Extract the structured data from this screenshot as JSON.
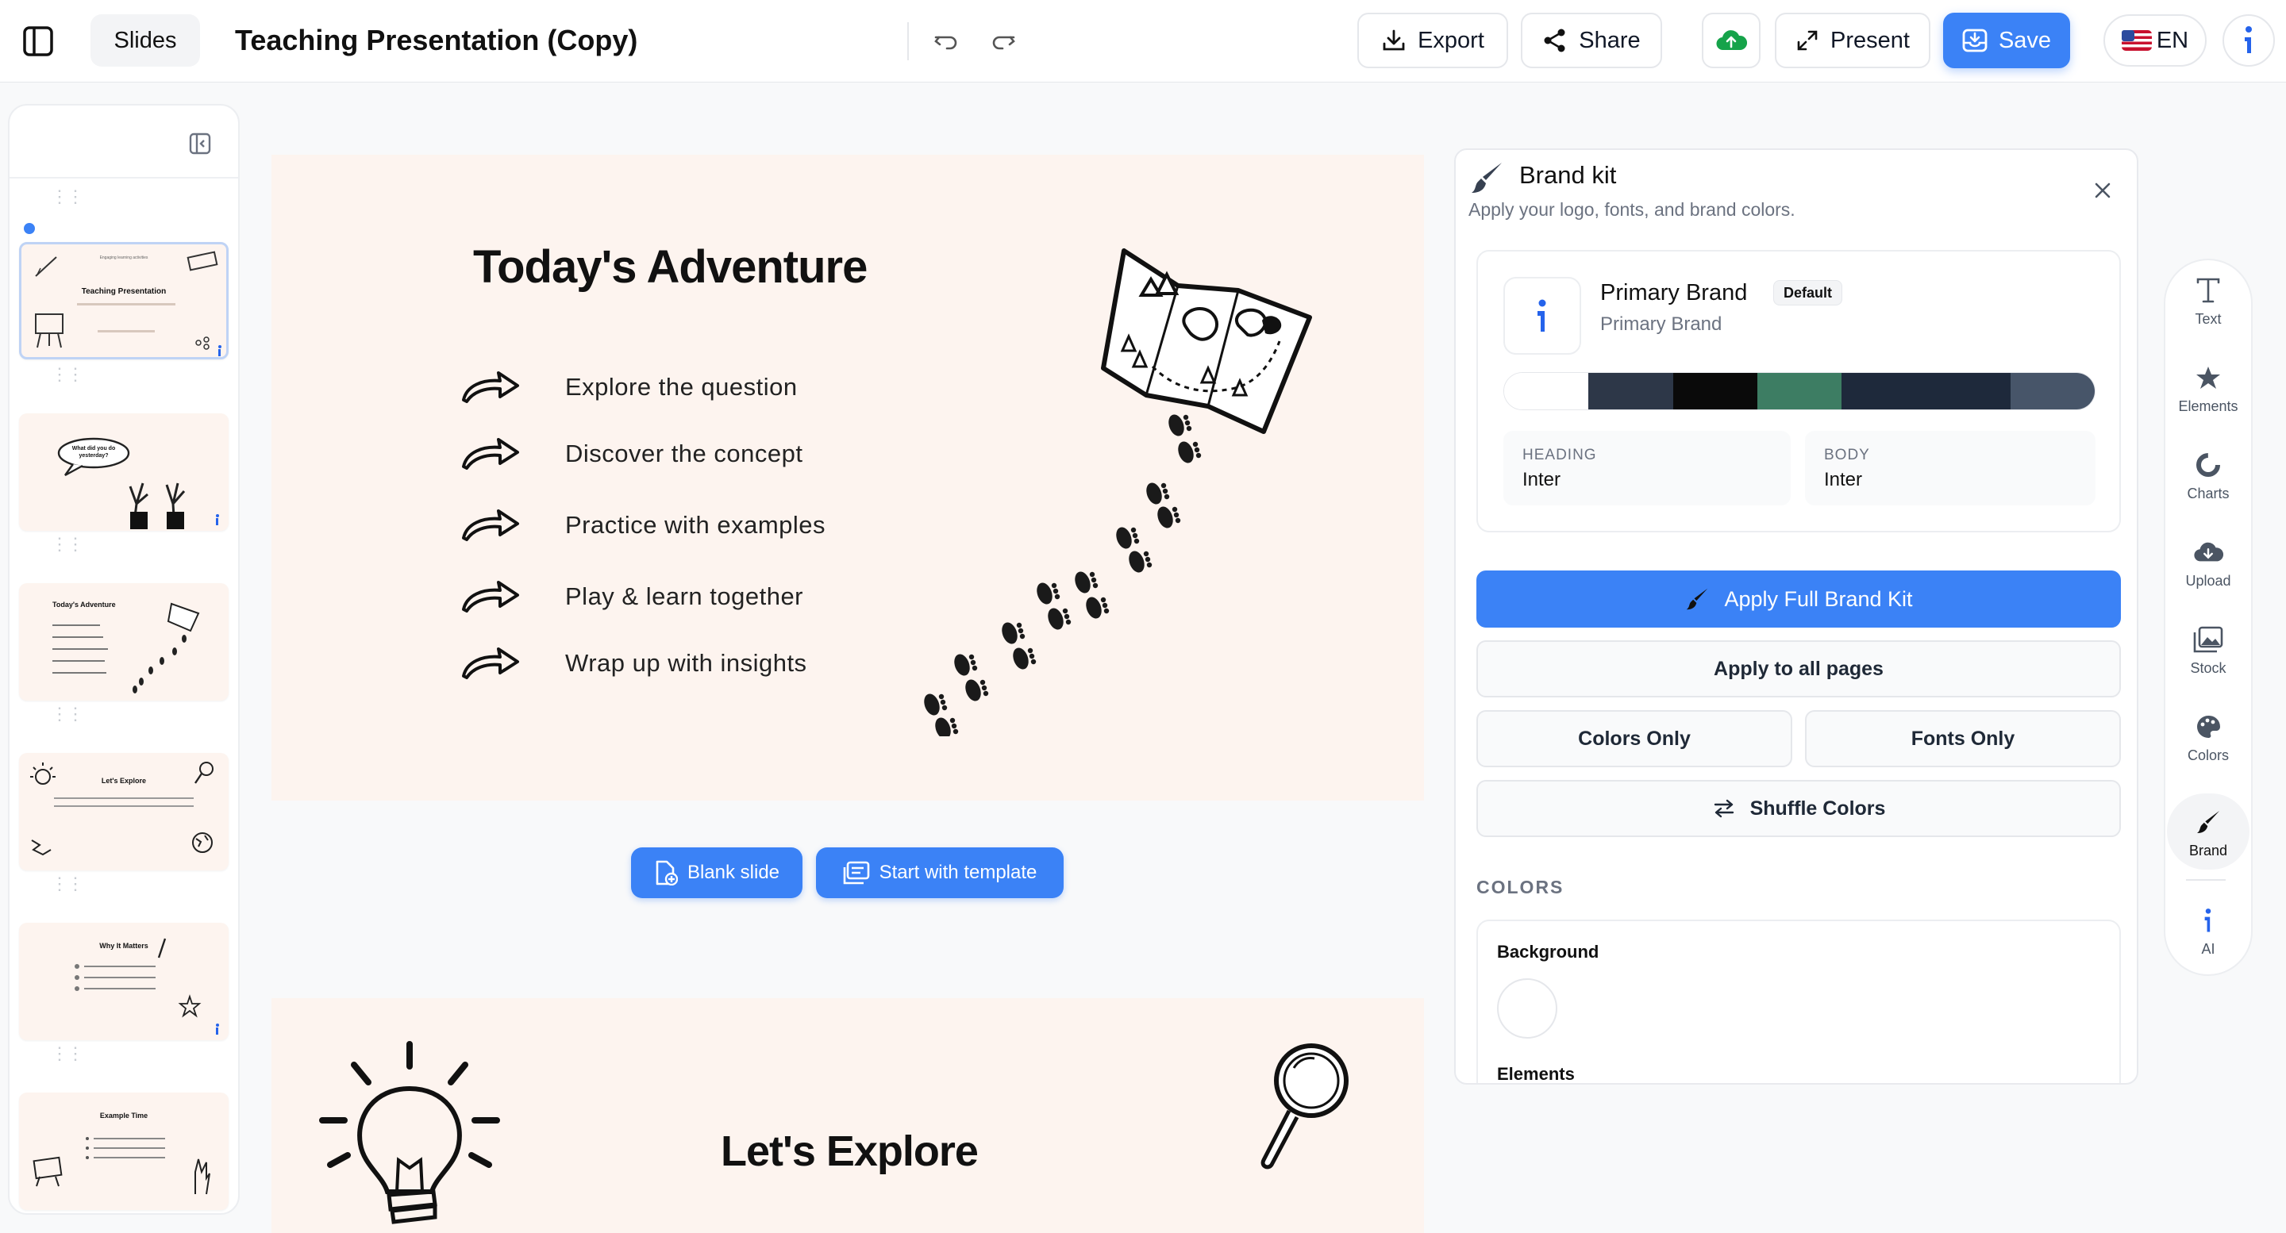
{
  "header": {
    "slides_label": "Slides",
    "title": "Teaching Presentation (Copy)",
    "export_label": "Export",
    "share_label": "Share",
    "present_label": "Present",
    "save_label": "Save",
    "language_label": "EN"
  },
  "slides_panel": {
    "thumbnails": [
      {
        "title": "Teaching Presentation",
        "subtitle": "Engaging learning activities",
        "selected": true
      },
      {
        "title": "What did you do yesterday?",
        "selected": false
      },
      {
        "title": "Today's Adventure",
        "selected": false
      },
      {
        "title": "Let's Explore",
        "selected": false
      },
      {
        "title": "Why It Matters",
        "selected": false
      },
      {
        "title": "Example Time",
        "selected": false
      }
    ]
  },
  "canvas": {
    "slide1": {
      "title": "Today's Adventure",
      "bullets": [
        "Explore the question",
        "Discover the concept",
        "Practice with examples",
        "Play & learn together",
        "Wrap up with insights"
      ]
    },
    "blank_slide_label": "Blank slide",
    "template_label": "Start with template",
    "slide2": {
      "title": "Let's Explore"
    }
  },
  "brand_panel": {
    "title": "Brand kit",
    "subtitle": "Apply your logo, fonts, and brand colors.",
    "brand_name": "Primary Brand",
    "brand_sub": "Primary Brand",
    "badge": "Default",
    "palette": [
      "#ffffff",
      "#2d3748",
      "#0a0a0a",
      "#3d7d63",
      "#1e293b",
      "#1e293b",
      "#475569"
    ],
    "heading_label": "HEADING",
    "heading_font": "Inter",
    "body_label": "BODY",
    "body_font": "Inter",
    "apply_full_label": "Apply Full Brand Kit",
    "apply_all_label": "Apply to all pages",
    "colors_only_label": "Colors Only",
    "fonts_only_label": "Fonts Only",
    "shuffle_label": "Shuffle Colors",
    "colors_section": "COLORS",
    "background_label": "Background",
    "elements_label": "Elements"
  },
  "toolbar": {
    "items": [
      {
        "label": "Text",
        "icon": "text-icon"
      },
      {
        "label": "Elements",
        "icon": "star-icon"
      },
      {
        "label": "Charts",
        "icon": "chart-icon"
      },
      {
        "label": "Upload",
        "icon": "upload-icon"
      },
      {
        "label": "Stock",
        "icon": "image-icon"
      },
      {
        "label": "Colors",
        "icon": "palette-icon"
      },
      {
        "label": "Brand",
        "icon": "brush-icon"
      },
      {
        "label": "AI",
        "icon": "ai-icon"
      }
    ]
  },
  "colors": {
    "accent": "#3b82f6",
    "slide_bg": "#fdf4ef",
    "cloud_green": "#16a34a"
  }
}
